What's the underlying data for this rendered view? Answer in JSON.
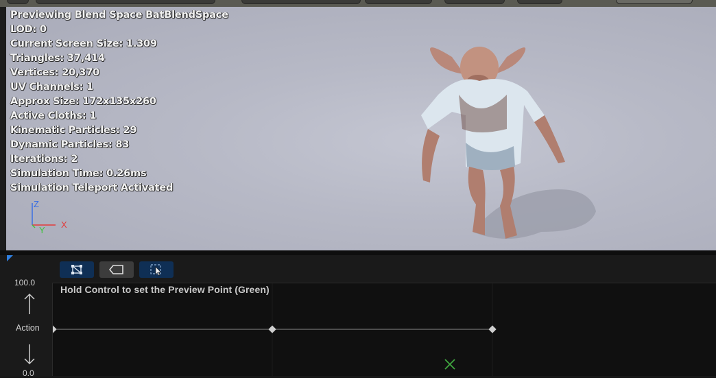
{
  "stats": {
    "title": "Previewing Blend Space BatBlendSpace",
    "lines": [
      "LOD: 0",
      "Current Screen Size: 1.309",
      "Triangles: 37,414",
      "Vertices: 20,370",
      "UV Channels: 1",
      "Approx Size: 172x135x260",
      "Active Cloths: 1",
      "Kinematic Particles: 29",
      "Dynamic Particles: 83",
      "Iterations: 2",
      "Simulation Time: 0.26ms",
      "Simulation Teleport Activated"
    ]
  },
  "axis_gizmo": {
    "z": "Z",
    "x": "X",
    "y": "Y"
  },
  "toolbar": {
    "buttons": [
      {
        "icon": "edit-grid-icon",
        "active": true
      },
      {
        "icon": "tag-icon",
        "active": false
      },
      {
        "icon": "select-pointer-icon",
        "active": true
      }
    ]
  },
  "blend_graph": {
    "hint": "Hold Control to set the Preview Point (Green)",
    "y_axis": {
      "max_label": "100.0",
      "min_label": "0.0",
      "name": "Action"
    },
    "sample_points": 3,
    "preview_color": "#3fa83f"
  },
  "colors": {
    "accent_blue": "#2f7fe0",
    "active_button": "#0f2f55",
    "inactive_button": "#3c3c3c",
    "axis_x": "#e23b3b",
    "axis_y": "#3fc33f",
    "axis_z": "#3a6fe3"
  }
}
